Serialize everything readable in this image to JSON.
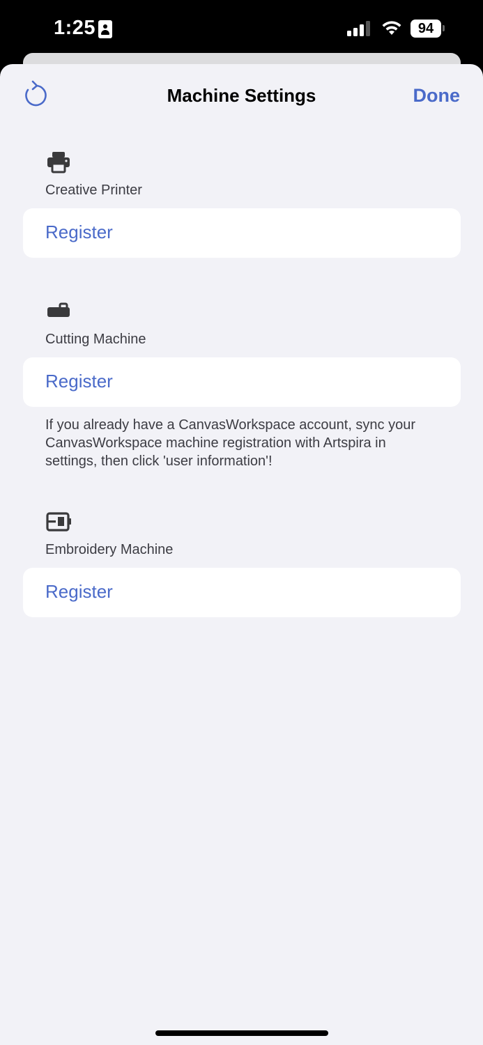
{
  "status_bar": {
    "time": "1:25",
    "battery": "94",
    "icons": [
      "contact-card-icon",
      "cellular-signal-icon",
      "wifi-icon",
      "battery-icon"
    ]
  },
  "nav": {
    "title": "Machine Settings",
    "done_label": "Done",
    "refresh_icon": "refresh-icon"
  },
  "sections": [
    {
      "icon": "printer-icon",
      "label": "Creative Printer",
      "button_label": "Register"
    },
    {
      "icon": "cutting-machine-icon",
      "label": "Cutting Machine",
      "button_label": "Register"
    },
    {
      "icon": "embroidery-machine-icon",
      "label": "Embroidery Machine",
      "button_label": "Register"
    }
  ],
  "note": "If you already have a CanvasWorkspace account, sync your CanvasWorkspace machine registration with Artspira in settings, then click 'user information'!",
  "colors": {
    "accent": "#4a6ac9",
    "background": "#f2f2f7",
    "card": "#ffffff",
    "label": "#3c3c43"
  }
}
